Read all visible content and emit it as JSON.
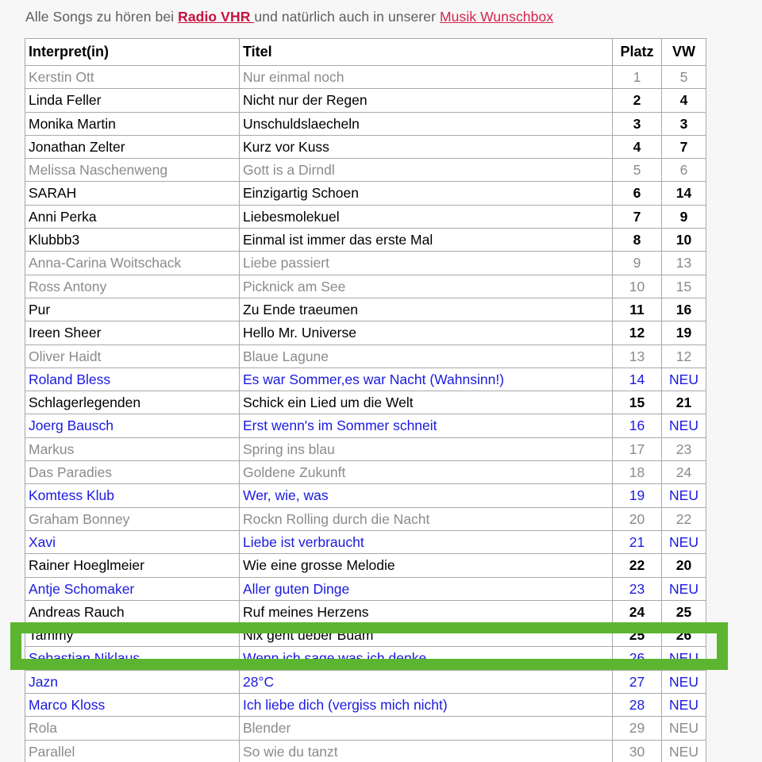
{
  "intro": {
    "part1": "Alle Songs zu hören bei ",
    "link_radio": "Radio VHR ",
    "part2": "und natürlich auch in unserer ",
    "link_wunschbox": "Musik Wunschbox"
  },
  "colors": {
    "page_background": "#f7f7f7",
    "intro_text": "#5e5e5e",
    "link_radio": "#c8103c",
    "link_wunschbox": "#d4254c",
    "row_black": "#000000",
    "row_gray": "#8b8b8b",
    "row_blue": "#1a1ae0",
    "highlight_green": "#5cb531",
    "table_border": "#a9a9a9",
    "cell_background": "#ffffff"
  },
  "table": {
    "columns": [
      {
        "key": "artist",
        "label": "Interpret(in)",
        "align": "left"
      },
      {
        "key": "title",
        "label": "Titel",
        "align": "left"
      },
      {
        "key": "platz",
        "label": "Platz",
        "align": "center"
      },
      {
        "key": "vw",
        "label": "VW",
        "align": "center"
      }
    ],
    "rows": [
      {
        "artist": "Kerstin Ott",
        "title": "Nur einmal noch",
        "platz": "1",
        "vw": "5",
        "style": "gray"
      },
      {
        "artist": "Linda Feller",
        "title": "Nicht nur der Regen",
        "platz": "2",
        "vw": "4",
        "style": "black"
      },
      {
        "artist": "Monika Martin",
        "title": "Unschuldslaecheln",
        "platz": "3",
        "vw": "3",
        "style": "black"
      },
      {
        "artist": "Jonathan Zelter",
        "title": "Kurz vor Kuss",
        "platz": "4",
        "vw": "7",
        "style": "black"
      },
      {
        "artist": "Melissa Naschenweng",
        "title": "Gott is a Dirndl",
        "platz": "5",
        "vw": "6",
        "style": "gray"
      },
      {
        "artist": "SARAH",
        "title": "Einzigartig Schoen",
        "platz": "6",
        "vw": "14",
        "style": "black"
      },
      {
        "artist": "Anni Perka",
        "title": "Liebesmolekuel",
        "platz": "7",
        "vw": "9",
        "style": "black"
      },
      {
        "artist": "Klubbb3",
        "title": "Einmal ist immer das erste Mal",
        "platz": "8",
        "vw": "10",
        "style": "black"
      },
      {
        "artist": "Anna-Carina Woitschack",
        "title": "Liebe passiert",
        "platz": "9",
        "vw": "13",
        "style": "gray"
      },
      {
        "artist": "Ross Antony",
        "title": "Picknick am See",
        "platz": "10",
        "vw": "15",
        "style": "gray"
      },
      {
        "artist": "Pur",
        "title": "Zu Ende traeumen",
        "platz": "11",
        "vw": "16",
        "style": "black"
      },
      {
        "artist": "Ireen Sheer",
        "title": "Hello Mr. Universe",
        "platz": "12",
        "vw": "19",
        "style": "black"
      },
      {
        "artist": "Oliver Haidt",
        "title": "Blaue Lagune",
        "platz": "13",
        "vw": "12",
        "style": "gray"
      },
      {
        "artist": "Roland Bless",
        "title": "Es war Sommer,es war Nacht (Wahnsinn!)",
        "platz": "14",
        "vw": "NEU",
        "style": "blue"
      },
      {
        "artist": "Schlagerlegenden",
        "title": "Schick ein Lied um die Welt",
        "platz": "15",
        "vw": "21",
        "style": "black"
      },
      {
        "artist": "Joerg Bausch",
        "title": "Erst wenn's im Sommer schneit",
        "platz": "16",
        "vw": "NEU",
        "style": "blue"
      },
      {
        "artist": "Markus",
        "title": "Spring ins blau",
        "platz": "17",
        "vw": "23",
        "style": "gray"
      },
      {
        "artist": "Das Paradies",
        "title": "Goldene Zukunft",
        "platz": "18",
        "vw": "24",
        "style": "gray"
      },
      {
        "artist": "Komtess Klub",
        "title": "Wer, wie, was",
        "platz": "19",
        "vw": "NEU",
        "style": "blue"
      },
      {
        "artist": "Graham Bonney",
        "title": "Rockn Rolling durch die Nacht",
        "platz": "20",
        "vw": "22",
        "style": "gray"
      },
      {
        "artist": "Xavi",
        "title": "Liebe ist verbraucht",
        "platz": "21",
        "vw": "NEU",
        "style": "blue"
      },
      {
        "artist": "Rainer Hoeglmeier",
        "title": "Wie eine grosse Melodie",
        "platz": "22",
        "vw": "20",
        "style": "black"
      },
      {
        "artist": "Antje Schomaker",
        "title": "Aller guten Dinge",
        "platz": "23",
        "vw": "NEU",
        "style": "blue"
      },
      {
        "artist": "Andreas Rauch",
        "title": "Ruf meines Herzens",
        "platz": "24",
        "vw": "25",
        "style": "black"
      },
      {
        "artist": "Tammy",
        "title": "Nix geht ueber Buam",
        "platz": "25",
        "vw": "26",
        "style": "black"
      },
      {
        "artist": "Sebastian Niklaus",
        "title": "Wenn ich sage was ich denke",
        "platz": "26",
        "vw": "NEU",
        "style": "blue"
      },
      {
        "artist": "Jazn",
        "title": "28°C",
        "platz": "27",
        "vw": "NEU",
        "style": "blue"
      },
      {
        "artist": "Marco Kloss",
        "title": "Ich liebe dich (vergiss mich nicht)",
        "platz": "28",
        "vw": "NEU",
        "style": "blue"
      },
      {
        "artist": "Rola",
        "title": "Blender",
        "platz": "29",
        "vw": "NEU",
        "style": "gray"
      },
      {
        "artist": "Parallel",
        "title": "So wie du tanzt",
        "platz": "30",
        "vw": "NEU",
        "style": "gray"
      }
    ]
  },
  "highlight": {
    "target_platz": "26",
    "target_artist": "Sebastian Niklaus"
  }
}
